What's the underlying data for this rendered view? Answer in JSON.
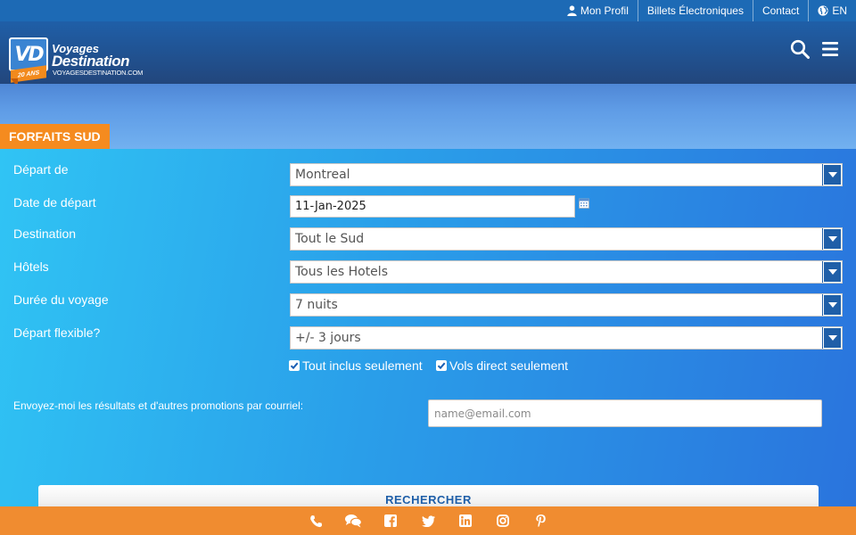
{
  "topbar": {
    "items": [
      {
        "label": "Mon Profil",
        "icon": "user-icon"
      },
      {
        "label": "Billets Électroniques"
      },
      {
        "label": "Contact"
      },
      {
        "label": "EN",
        "icon": "globe-icon"
      }
    ]
  },
  "logo": {
    "mark": "VD",
    "anniversary": "20 ANS",
    "line1": "Voyages",
    "line2": "Destination",
    "url": "VOYAGESDESTINATION.COM"
  },
  "header": {
    "search_icon": "search-icon",
    "menu_icon": "hamburger-menu-icon"
  },
  "tab": {
    "label": "FORFAITS SUD"
  },
  "form": {
    "departure": {
      "label": "Départ de",
      "value": "Montreal"
    },
    "date": {
      "label": "Date de départ",
      "value": "11-Jan-2025"
    },
    "destination": {
      "label": "Destination",
      "value": "Tout le Sud"
    },
    "hotels": {
      "label": "Hôtels",
      "value": "Tous les Hotels"
    },
    "duration": {
      "label": "Durée du voyage",
      "value": "7 nuits"
    },
    "flexible": {
      "label": "Départ flexible?",
      "value": "+/- 3 jours"
    },
    "all_inclusive": {
      "label": "Tout inclus seulement",
      "checked": true
    },
    "direct_flights": {
      "label": "Vols direct seulement",
      "checked": true
    },
    "email": {
      "label": "Envoyez-moi les résultats et d'autres promotions par courriel:",
      "placeholder": "name@email.com"
    },
    "search_button": "RECHERCHER"
  },
  "footer": {
    "icons": [
      "phone-icon",
      "chat-icon",
      "facebook-icon",
      "twitter-icon",
      "linkedin-icon",
      "instagram-icon",
      "pinterest-icon"
    ]
  },
  "colors": {
    "topbar": "#1d6ab5",
    "header": "#22467c",
    "tab": "#f58b1f",
    "footer": "#f08c30",
    "select_arrow": "#1f5fa8"
  }
}
